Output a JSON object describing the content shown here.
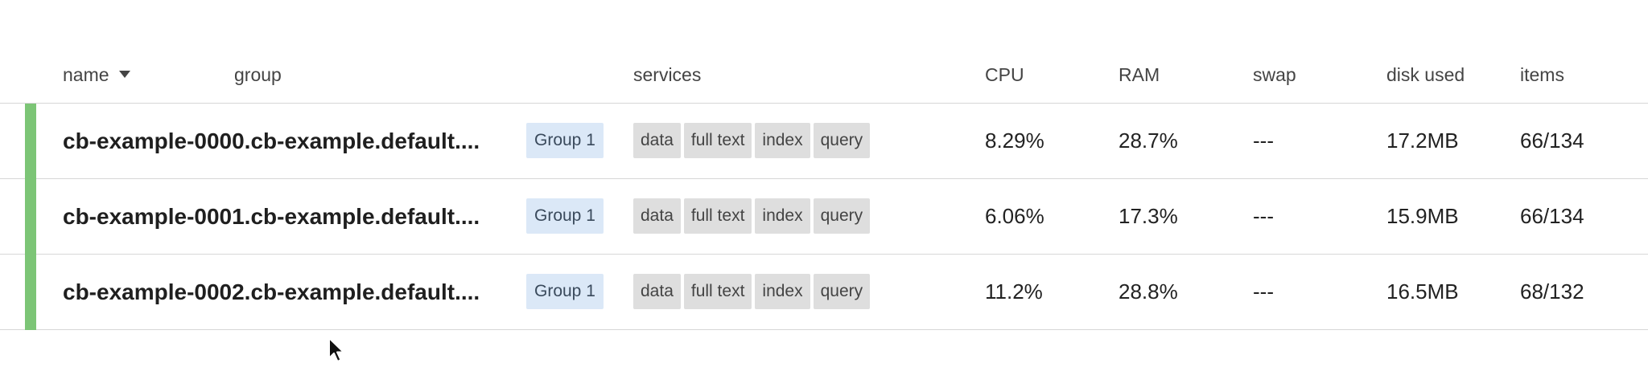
{
  "columns": {
    "name": "name",
    "group": "group",
    "services": "services",
    "cpu": "CPU",
    "ram": "RAM",
    "swap": "swap",
    "disk_used": "disk used",
    "items": "items"
  },
  "status_color": "#7cc576",
  "rows": [
    {
      "name": "cb-example-0000.cb-example.default....",
      "group": "Group 1",
      "services": [
        "data",
        "full text",
        "index",
        "query"
      ],
      "cpu": "8.29%",
      "ram": "28.7%",
      "swap": "---",
      "disk_used": "17.2MB",
      "items": "66/134"
    },
    {
      "name": "cb-example-0001.cb-example.default....",
      "group": "Group 1",
      "services": [
        "data",
        "full text",
        "index",
        "query"
      ],
      "cpu": "6.06%",
      "ram": "17.3%",
      "swap": "---",
      "disk_used": "15.9MB",
      "items": "66/134"
    },
    {
      "name": "cb-example-0002.cb-example.default....",
      "group": "Group 1",
      "services": [
        "data",
        "full text",
        "index",
        "query"
      ],
      "cpu": "11.2%",
      "ram": "28.8%",
      "swap": "---",
      "disk_used": "16.5MB",
      "items": "68/132"
    }
  ]
}
